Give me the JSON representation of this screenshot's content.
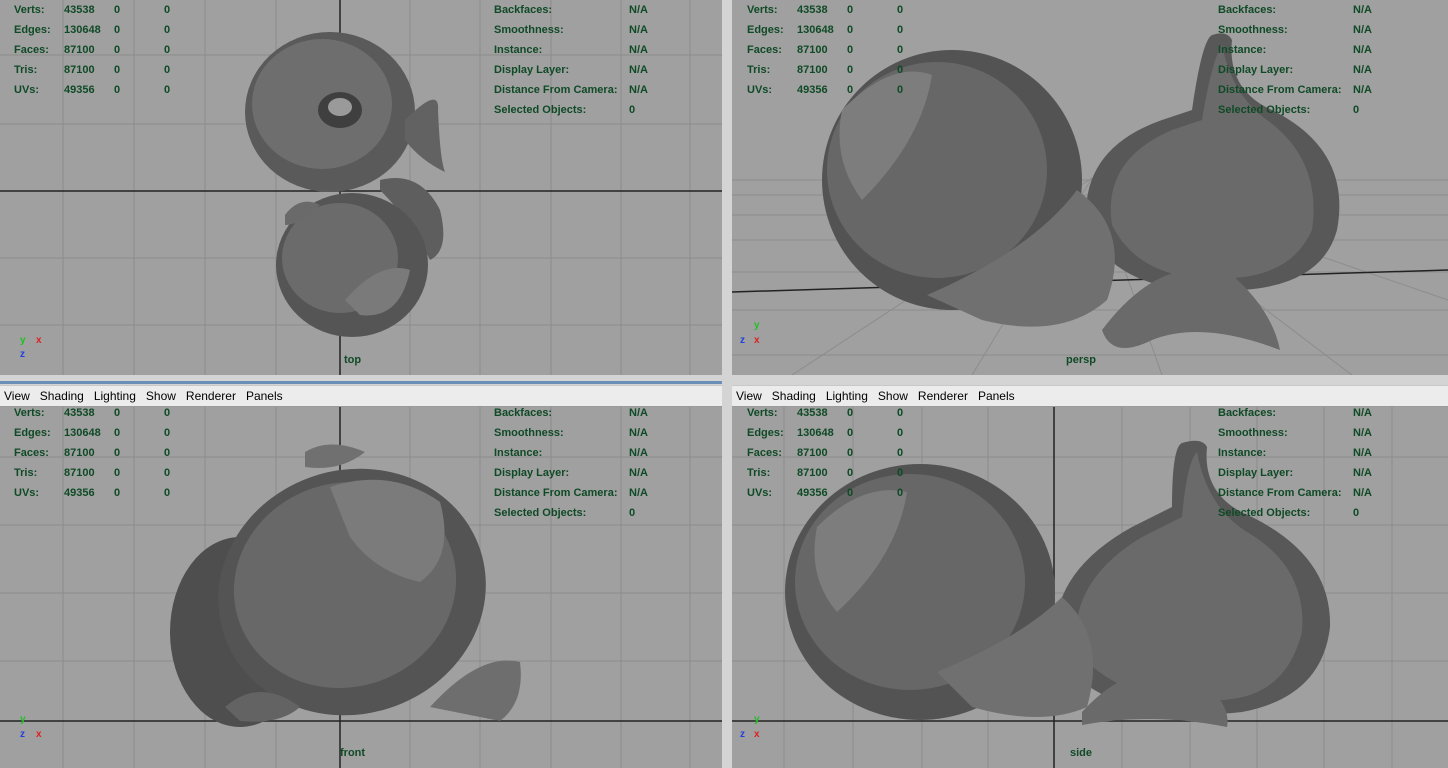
{
  "menu": [
    "View",
    "Shading",
    "Lighting",
    "Show",
    "Renderer",
    "Panels"
  ],
  "hud_left": {
    "labels": [
      "Verts:",
      "Edges:",
      "Faces:",
      "Tris:",
      "UVs:"
    ],
    "values": [
      [
        "43538",
        "0",
        "0"
      ],
      [
        "130648",
        "0",
        "0"
      ],
      [
        "87100",
        "0",
        "0"
      ],
      [
        "87100",
        "0",
        "0"
      ],
      [
        "49356",
        "0",
        "0"
      ]
    ]
  },
  "hud_right": {
    "labels": [
      "Backfaces:",
      "Smoothness:",
      "Instance:",
      "Display Layer:",
      "Distance From Camera:",
      "Selected Objects:"
    ],
    "values": [
      "N/A",
      "N/A",
      "N/A",
      "N/A",
      "N/A",
      "0"
    ]
  },
  "viewports": [
    {
      "camera": "top",
      "axes": [
        "y",
        "x",
        "z"
      ]
    },
    {
      "camera": "persp",
      "axes": [
        "y",
        "z",
        "x"
      ]
    },
    {
      "camera": "front",
      "axes": [
        "y",
        "z",
        "x"
      ]
    },
    {
      "camera": "side",
      "axes": [
        "y",
        "z",
        "x"
      ]
    }
  ],
  "colors": {
    "viewport_bg": "#a0a0a0",
    "hud_text": "#0f4a26",
    "axis_x": "#e02020",
    "axis_y": "#20c020",
    "axis_z": "#2040e0"
  }
}
